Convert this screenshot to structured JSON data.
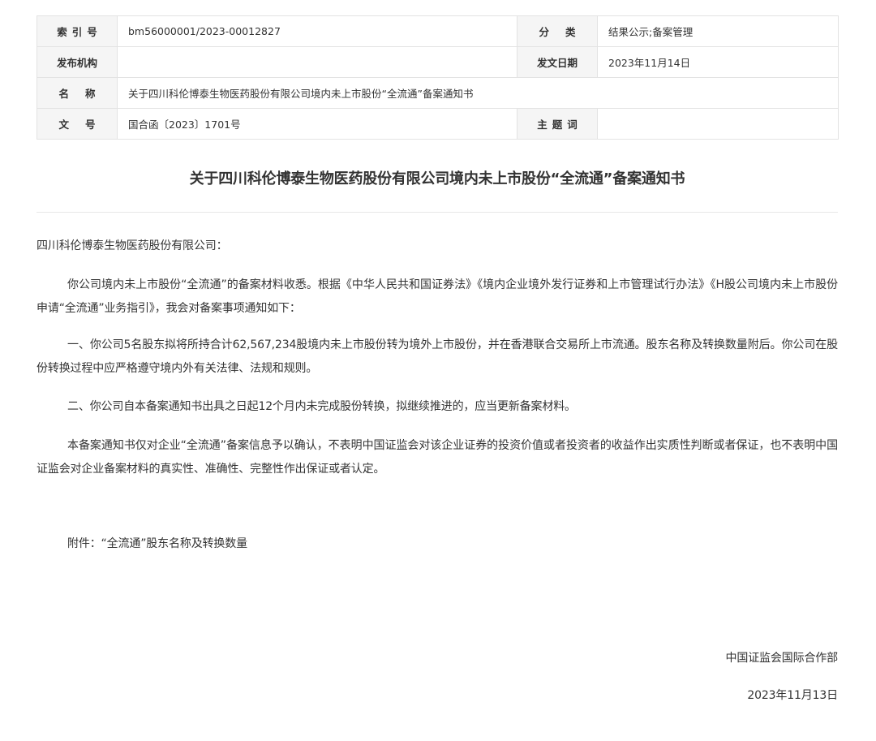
{
  "meta": {
    "index_label": "索引号",
    "index_value": "bm56000001/2023-00012827",
    "category_label": "分类",
    "category_value": "结果公示;备案管理",
    "issuer_label": "发布机构",
    "issuer_value": "",
    "date_label": "发文日期",
    "date_value": "2023年11月14日",
    "name_label": "名称",
    "name_value": "关于四川科伦博泰生物医药股份有限公司境内未上市股份“全流通”备案通知书",
    "docno_label": "文号",
    "docno_value": "国合函〔2023〕1701号",
    "subject_label": "主题词",
    "subject_value": ""
  },
  "document": {
    "title": "关于四川科伦博泰生物医药股份有限公司境内未上市股份“全流通”备案通知书",
    "salutation": "四川科伦博泰生物医药股份有限公司：",
    "para1": "你公司境内未上市股份“全流通”的备案材料收悉。根据《中华人民共和国证券法》《境内企业境外发行证券和上市管理试行办法》《H股公司境内未上市股份申请“全流通”业务指引》，我会对备案事项通知如下：",
    "para2": "一、你公司5名股东拟将所持合计62,567,234股境内未上市股份转为境外上市股份，并在香港联合交易所上市流通。股东名称及转换数量附后。你公司在股份转换过程中应严格遵守境内外有关法律、法规和规则。",
    "para3": "二、你公司自本备案通知书出具之日起12个月内未完成股份转换，拟继续推进的，应当更新备案材料。",
    "para4": "本备案通知书仅对企业“全流通”备案信息予以确认，不表明中国证监会对该企业证券的投资价值或者投资者的收益作出实质性判断或者保证，也不表明中国证监会对企业备案材料的真实性、准确性、完整性作出保证或者认定。",
    "attachment": "附件：“全流通”股东名称及转换数量",
    "signature": "中国证监会国际合作部",
    "sign_date": "2023年11月13日"
  }
}
